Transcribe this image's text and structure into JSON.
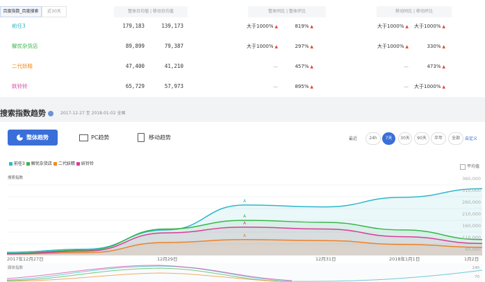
{
  "filters": {
    "active": "百度指数_百度搜索",
    "inactive": "近30天"
  },
  "table": {
    "hdr_avg": "整体日均值 | 移动日均值",
    "hdr_yoy": "整体同比 | 整体环比",
    "hdr_mob": "移动同比 | 移动环比",
    "rows": [
      {
        "keyword": "前任3",
        "color": "#2db7c9",
        "overall": "179,183",
        "mobile": "139,173",
        "yoy": "大于1000%",
        "mom": "819%",
        "mob_yoy": "大于1000%",
        "mob_mom": "大于1000%"
      },
      {
        "keyword": "解忧杂货店",
        "color": "#3bb44a",
        "overall": "89,899",
        "mobile": "79,387",
        "yoy": "大于1000%",
        "mom": "297%",
        "mob_yoy": "大于1000%",
        "mob_mom": "330%"
      },
      {
        "keyword": "二代妖精",
        "color": "#f08a1c",
        "overall": "47,400",
        "mobile": "41,210",
        "yoy": "—",
        "mom": "457%",
        "mob_yoy": "—",
        "mob_mom": "473%"
      },
      {
        "keyword": "妖铃铃",
        "color": "#d63d9c",
        "overall": "65,729",
        "mobile": "57,973",
        "yoy": "—",
        "mom": "895%",
        "mob_yoy": "—",
        "mob_mom": "大于1000%"
      }
    ]
  },
  "trend": {
    "title": "搜索指数趋势",
    "dates": "2017-12-27 至 2018-01-02  全国",
    "btn_overall": "整体趋势",
    "btn_pc": "PC趋势",
    "btn_mobile": "移动趋势",
    "range_label": "最近",
    "ranges": [
      "24h",
      "7天",
      "30天",
      "90天",
      "半年",
      "全部"
    ],
    "custom": "自定义",
    "avg_label": "平均值",
    "ylabel": "搜索指数",
    "yticks": [
      "360,000",
      "310,000",
      "260,000",
      "210,000",
      "160,000",
      "110,000",
      "60,000"
    ],
    "xticks": [
      "2017年12月27日",
      "12月29日",
      "12月31日",
      "2018年1月1日",
      "1月2日"
    ],
    "mini_label": "媒体指数",
    "mini_ticks": [
      "140",
      "70"
    ],
    "annotation": "A"
  },
  "chart_data": {
    "type": "area",
    "x": [
      "2017-12-27",
      "2017-12-28",
      "2017-12-29",
      "2017-12-30",
      "2017-12-31",
      "2018-01-01",
      "2018-01-02"
    ],
    "ylim": [
      0,
      400000
    ],
    "series": [
      {
        "name": "前任3",
        "color": "#2db7c9",
        "values": [
          14000,
          30000,
          130000,
          260000,
          250000,
          300000,
          345000
        ]
      },
      {
        "name": "解忧杂货店",
        "color": "#3bb44a",
        "values": [
          8000,
          25000,
          135000,
          180000,
          170000,
          130000,
          80000
        ]
      },
      {
        "name": "二代妖精",
        "color": "#f08a1c",
        "values": [
          5000,
          12000,
          65000,
          80000,
          75000,
          55000,
          40000
        ]
      },
      {
        "name": "妖铃铃",
        "color": "#d63d9c",
        "values": [
          6000,
          20000,
          115000,
          145000,
          135000,
          95000,
          60000
        ]
      }
    ]
  }
}
